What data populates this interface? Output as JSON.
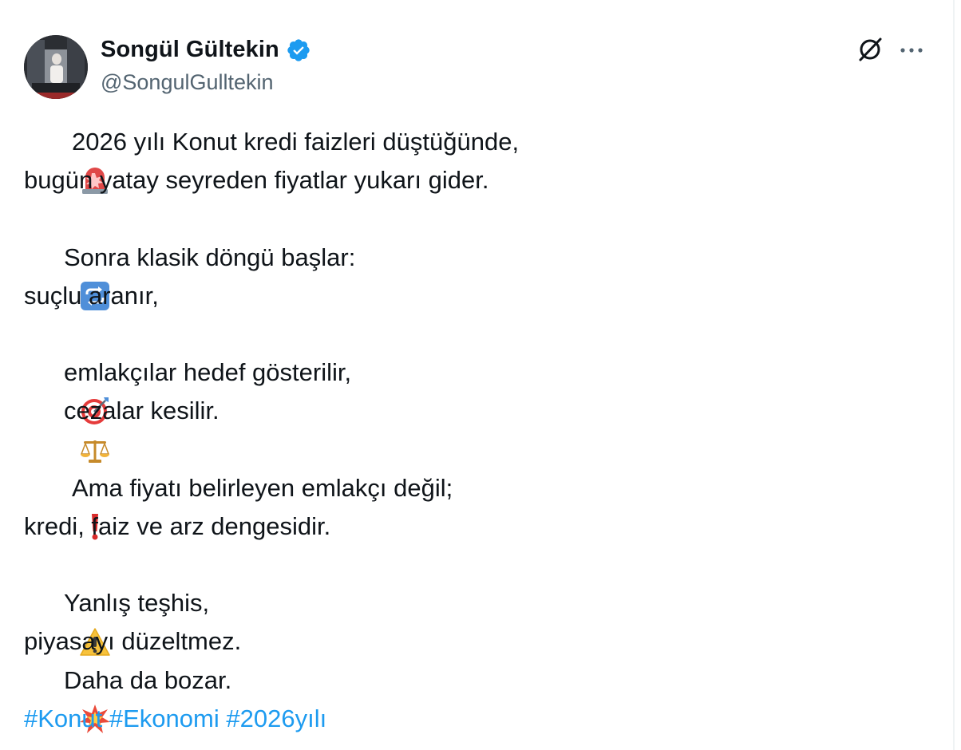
{
  "author": {
    "display_name": "Songül Gültekin",
    "handle": "@SongulGulltekin",
    "verified": true,
    "verified_color": "#1d9bf0"
  },
  "actions": {
    "grok_icon": "grok-icon",
    "more_icon": "more-horizontal-icon"
  },
  "tweet": {
    "lines": [
      {
        "emoji": "rotating-light",
        "text": "2026 yılı Konut kredi faizleri düştüğünde,"
      },
      {
        "emoji": "",
        "text": "bugün yatay seyreden fiyatlar yukarı gider."
      },
      {
        "emoji": "",
        "text": ""
      },
      {
        "emoji": "repeat-button",
        "text": "Sonra klasik döngü başlar:"
      },
      {
        "emoji": "",
        "text": "suçlu aranır,"
      },
      {
        "emoji": "",
        "text": ""
      },
      {
        "emoji": "direct-hit",
        "text": "emlakçılar hedef gösterilir,"
      },
      {
        "emoji": "balance-scale",
        "text": "cezalar kesilir."
      },
      {
        "emoji": "",
        "text": ""
      },
      {
        "emoji": "exclamation-mark",
        "text": "Ama fiyatı belirleyen emlakçı değil;"
      },
      {
        "emoji": "",
        "text": "kredi, faiz ve arz dengesidir."
      },
      {
        "emoji": "",
        "text": ""
      },
      {
        "emoji": "warning",
        "text": "Yanlış teşhis,"
      },
      {
        "emoji": "",
        "text": "piyasayı düzeltmez."
      },
      {
        "emoji": "collision",
        "text": "Daha da bozar."
      }
    ],
    "hashtags": [
      "#Konut",
      "#Ekonomi",
      "#2026yılı"
    ],
    "link_color": "#1d9bf0"
  }
}
